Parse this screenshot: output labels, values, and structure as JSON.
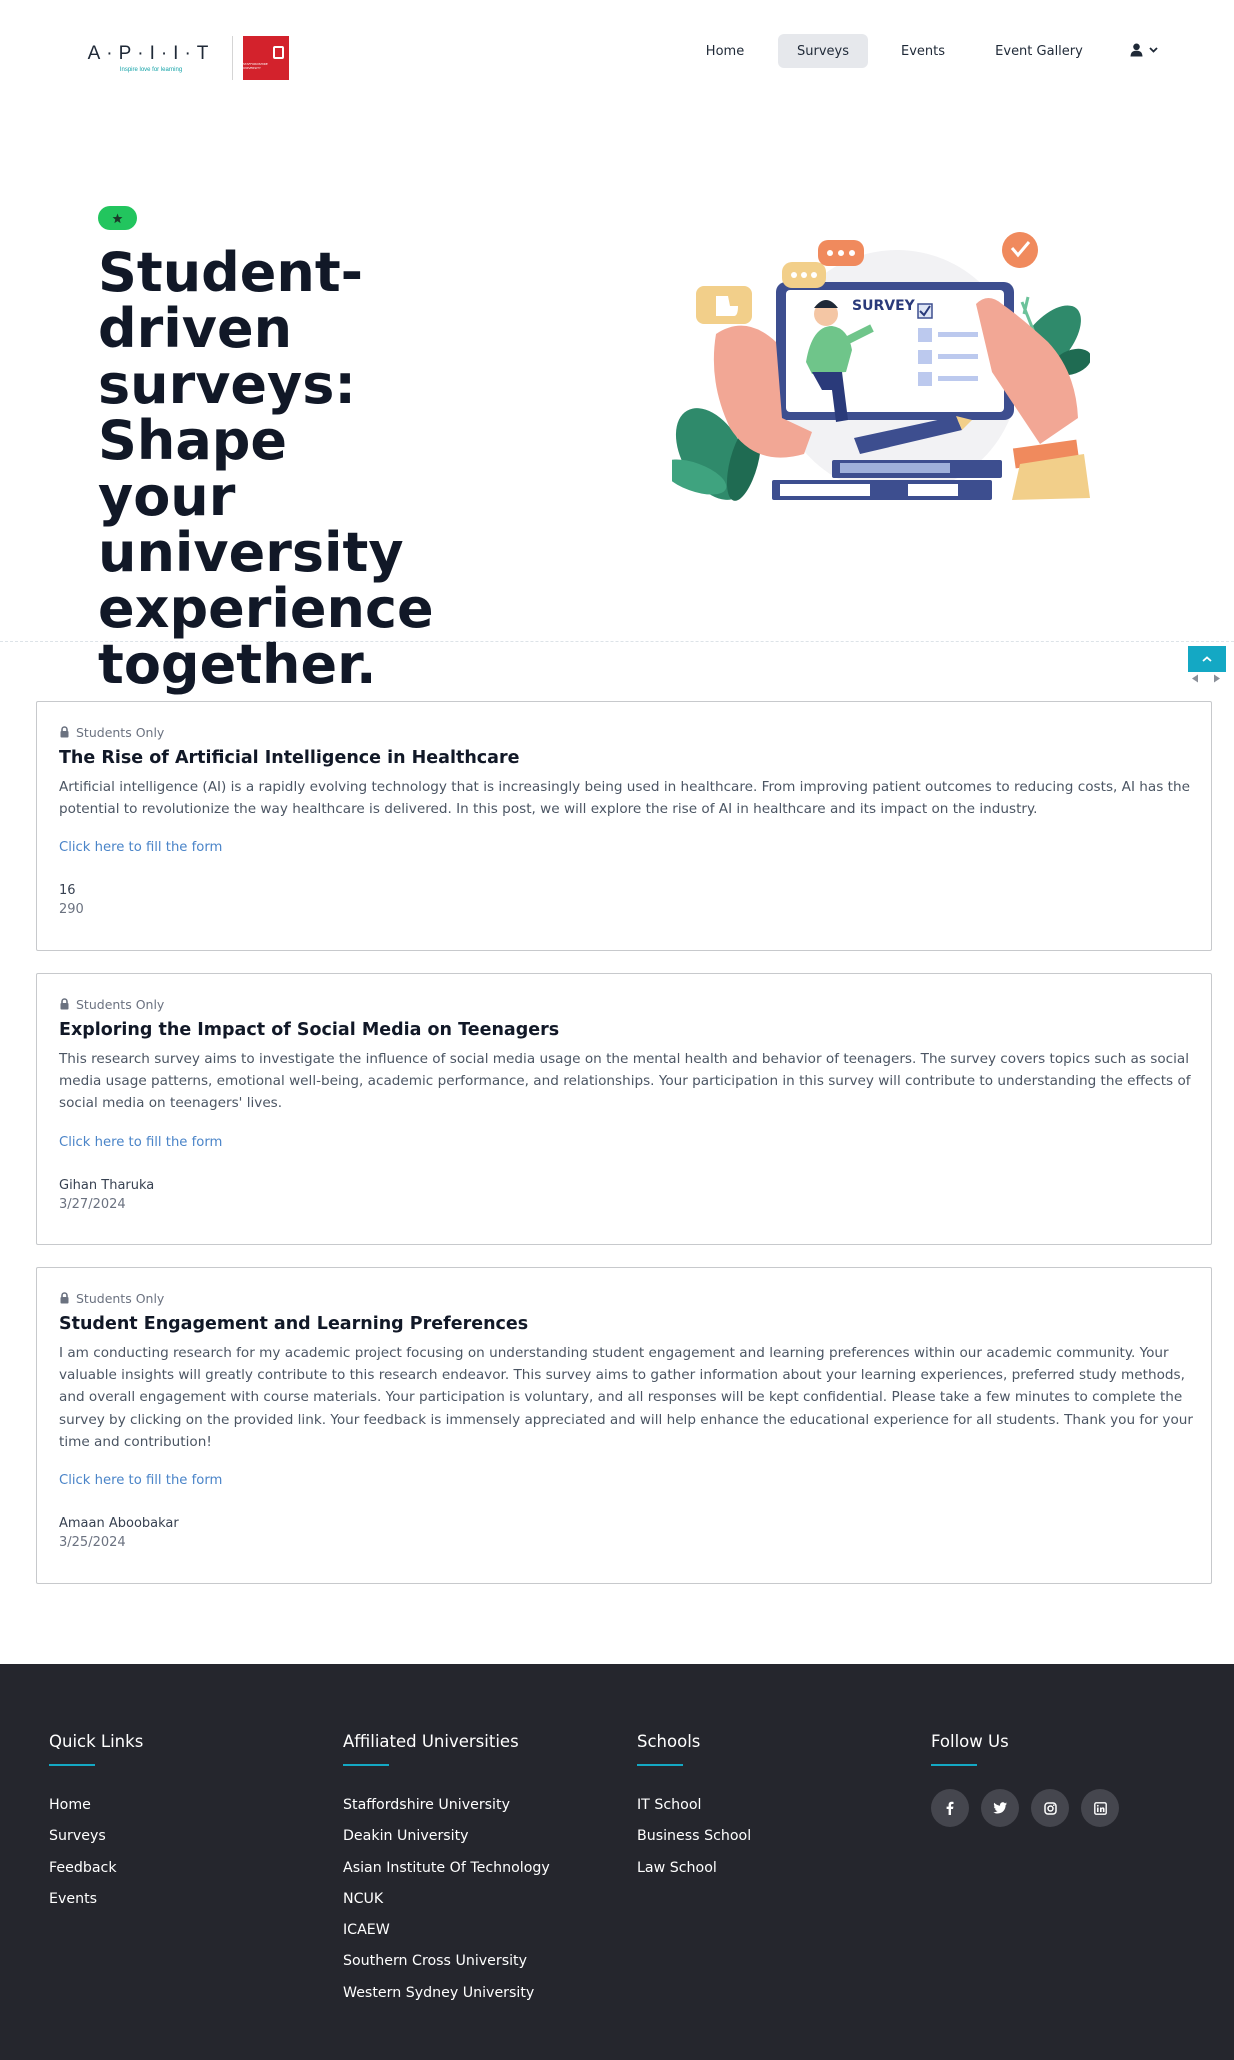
{
  "header": {
    "logo_primary": "A·P·I·I·T",
    "logo_tagline": "Inspire love for learning",
    "logo_secondary": "STAFFORDSHIRE UNIVERSITY",
    "nav": [
      {
        "label": "Home",
        "active": false
      },
      {
        "label": "Surveys",
        "active": true
      },
      {
        "label": "Events",
        "active": false
      },
      {
        "label": "Event Gallery",
        "active": false
      }
    ],
    "user_icon": "user-icon",
    "user_chevron": "chevron-down-icon"
  },
  "hero": {
    "badge_icon": "star-icon",
    "badge_color": "#22c55e",
    "title_lines": [
      "Student-driven",
      "surveys: Shape",
      "your university",
      "experience",
      "together."
    ],
    "illustration_label": "SURVEY"
  },
  "surveys": [
    {
      "access": "Students Only",
      "title": "The Rise of Artificial Intelligence in Healthcare",
      "description": "Artificial intelligence (AI) is a rapidly evolving technology that is increasingly being used in healthcare. From improving patient outcomes to reducing costs, AI has the potential to revolutionize the way healthcare is delivered. In this post, we will explore the rise of AI in healthcare and its impact on the industry.",
      "link": "Click here to fill the form",
      "meta_primary": "16",
      "meta_secondary": "290"
    },
    {
      "access": "Students Only",
      "title": "Exploring the Impact of Social Media on Teenagers",
      "description": "This research survey aims to investigate the influence of social media usage on the mental health and behavior of teenagers. The survey covers topics such as social media usage patterns, emotional well-being, academic performance, and relationships. Your participation in this survey will contribute to understanding the effects of social media on teenagers' lives.",
      "link": "Click here to fill the form",
      "meta_primary": "Gihan Tharuka",
      "meta_secondary": "3/27/2024"
    },
    {
      "access": "Students Only",
      "title": "Student Engagement and Learning Preferences",
      "description": "I am conducting research for my academic project focusing on understanding student engagement and learning preferences within our academic community. Your valuable insights will greatly contribute to this research endeavor. This survey aims to gather information about your learning experiences, preferred study methods, and overall engagement with course materials. Your participation is voluntary, and all responses will be kept confidential. Please take a few minutes to complete the survey by clicking on the provided link. Your feedback is immensely appreciated and will help enhance the educational experience for all students. Thank you for your time and contribution!",
      "link": "Click here to fill the form",
      "meta_primary": "Amaan Aboobakar",
      "meta_secondary": "3/25/2024"
    }
  ],
  "footer": {
    "background": "#25262d",
    "accent": "#14a8c4",
    "quick_links": {
      "heading": "Quick Links",
      "items": [
        "Home",
        "Surveys",
        "Feedback",
        "Events"
      ]
    },
    "universities": {
      "heading": "Affiliated Universities",
      "items": [
        "Staffordshire University",
        "Deakin University",
        "Asian Institute Of Technology",
        "NCUK",
        "ICAEW",
        "Southern Cross University",
        "Western Sydney University"
      ]
    },
    "schools": {
      "heading": "Schools",
      "items": [
        "IT School",
        "Business School",
        "Law School"
      ]
    },
    "follow": {
      "heading": "Follow Us",
      "icons": [
        "facebook-icon",
        "twitter-icon",
        "instagram-icon",
        "linkedin-icon"
      ]
    }
  }
}
